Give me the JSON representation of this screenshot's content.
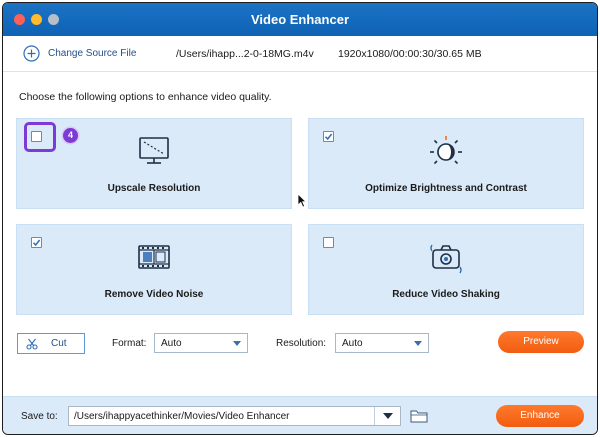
{
  "window": {
    "title": "Video Enhancer"
  },
  "source": {
    "change_label": "Change Source File",
    "path": "/Users/ihapp...2-0-18MG.m4v",
    "meta": "1920x1080/00:00:30/30.65 MB"
  },
  "instruction": "Choose the following options to enhance video quality.",
  "options": [
    {
      "label": "Upscale Resolution",
      "checked": false,
      "icon": "monitor-icon"
    },
    {
      "label": "Optimize Brightness and Contrast",
      "checked": true,
      "icon": "brightness-icon"
    },
    {
      "label": "Remove Video Noise",
      "checked": true,
      "icon": "film-icon"
    },
    {
      "label": "Reduce Video Shaking",
      "checked": false,
      "icon": "stabilize-camera-icon"
    }
  ],
  "step_badge": "4",
  "controls": {
    "cut_label": "Cut",
    "format_label": "Format:",
    "format_value": "Auto",
    "resolution_label": "Resolution:",
    "resolution_value": "Auto",
    "preview_label": "Preview"
  },
  "footer": {
    "save_label": "Save to:",
    "save_path": "/Users/ihappyacethinker/Movies/Video Enhancer",
    "enhance_label": "Enhance"
  },
  "colors": {
    "accent": "#1b73c4",
    "card": "#dbeaf8",
    "orange": "#f76a1f",
    "highlight": "#7c3bd6"
  }
}
